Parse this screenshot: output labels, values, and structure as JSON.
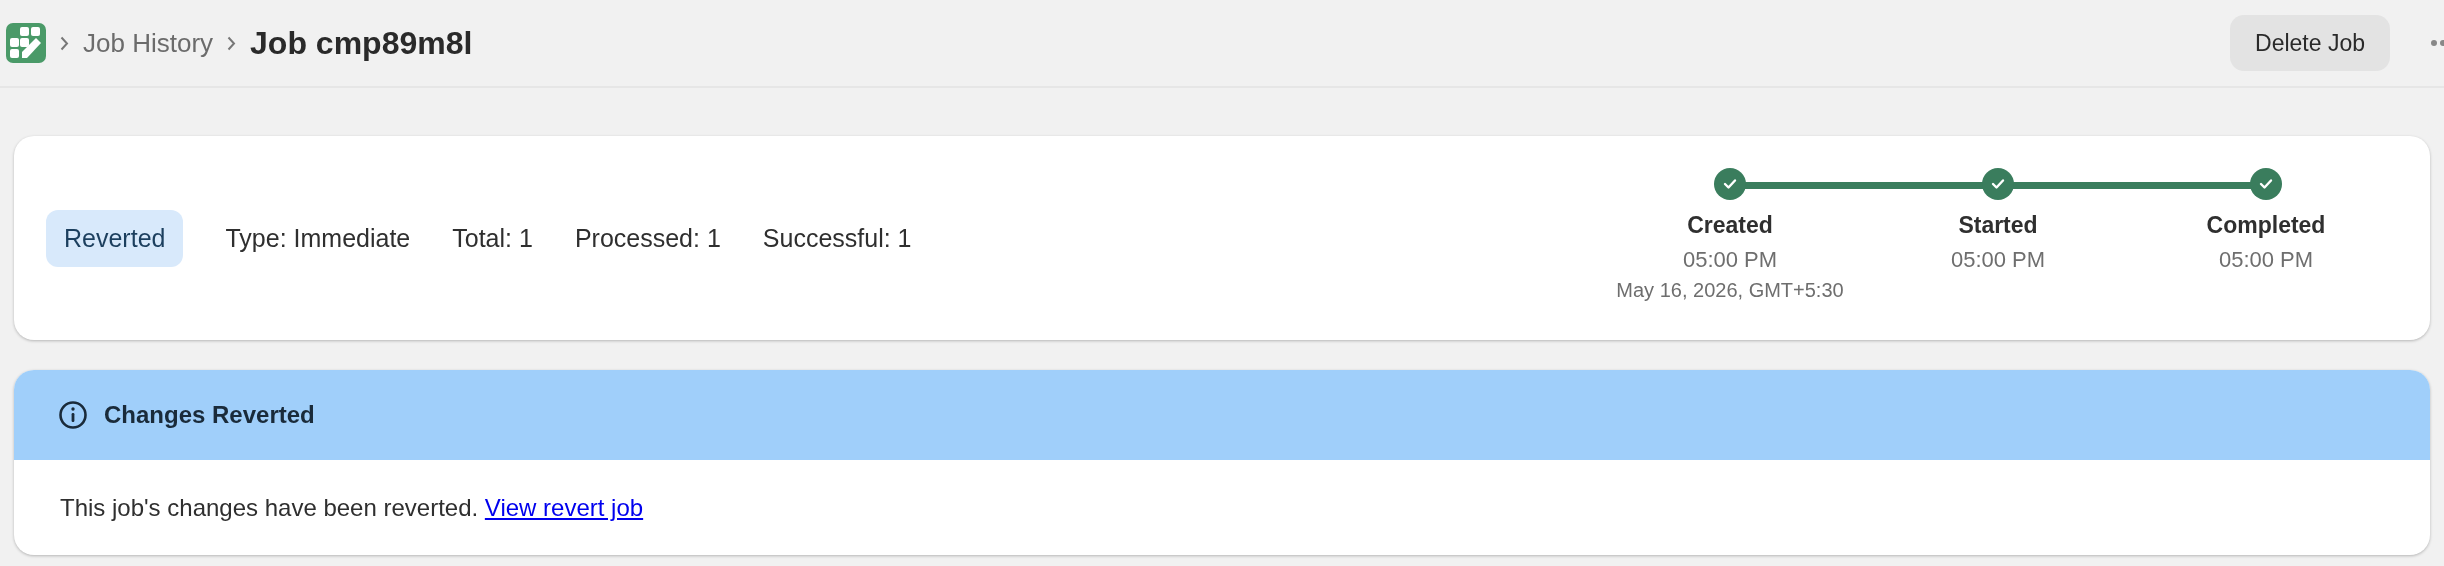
{
  "breadcrumb": {
    "items": [
      "Job History"
    ],
    "current": "Job cmp89m8l"
  },
  "header_actions": {
    "buttons": [
      "Delete Job"
    ]
  },
  "summary": {
    "status": "Reverted",
    "stats": [
      "Type: Immediate",
      "Total: 1",
      "Processed: 1",
      "Successful: 1"
    ],
    "timeline": [
      {
        "label": "Created",
        "time": "05:00 PM",
        "detail": "May 16, 2026, GMT+5:30",
        "done": true
      },
      {
        "label": "Started",
        "time": "05:00 PM",
        "done": true
      },
      {
        "label": "Completed",
        "time": "05:00 PM",
        "done": true
      }
    ]
  },
  "alert": {
    "title": "Changes Reverted",
    "message": "This job's changes have been reverted.",
    "link": "View revert job"
  }
}
